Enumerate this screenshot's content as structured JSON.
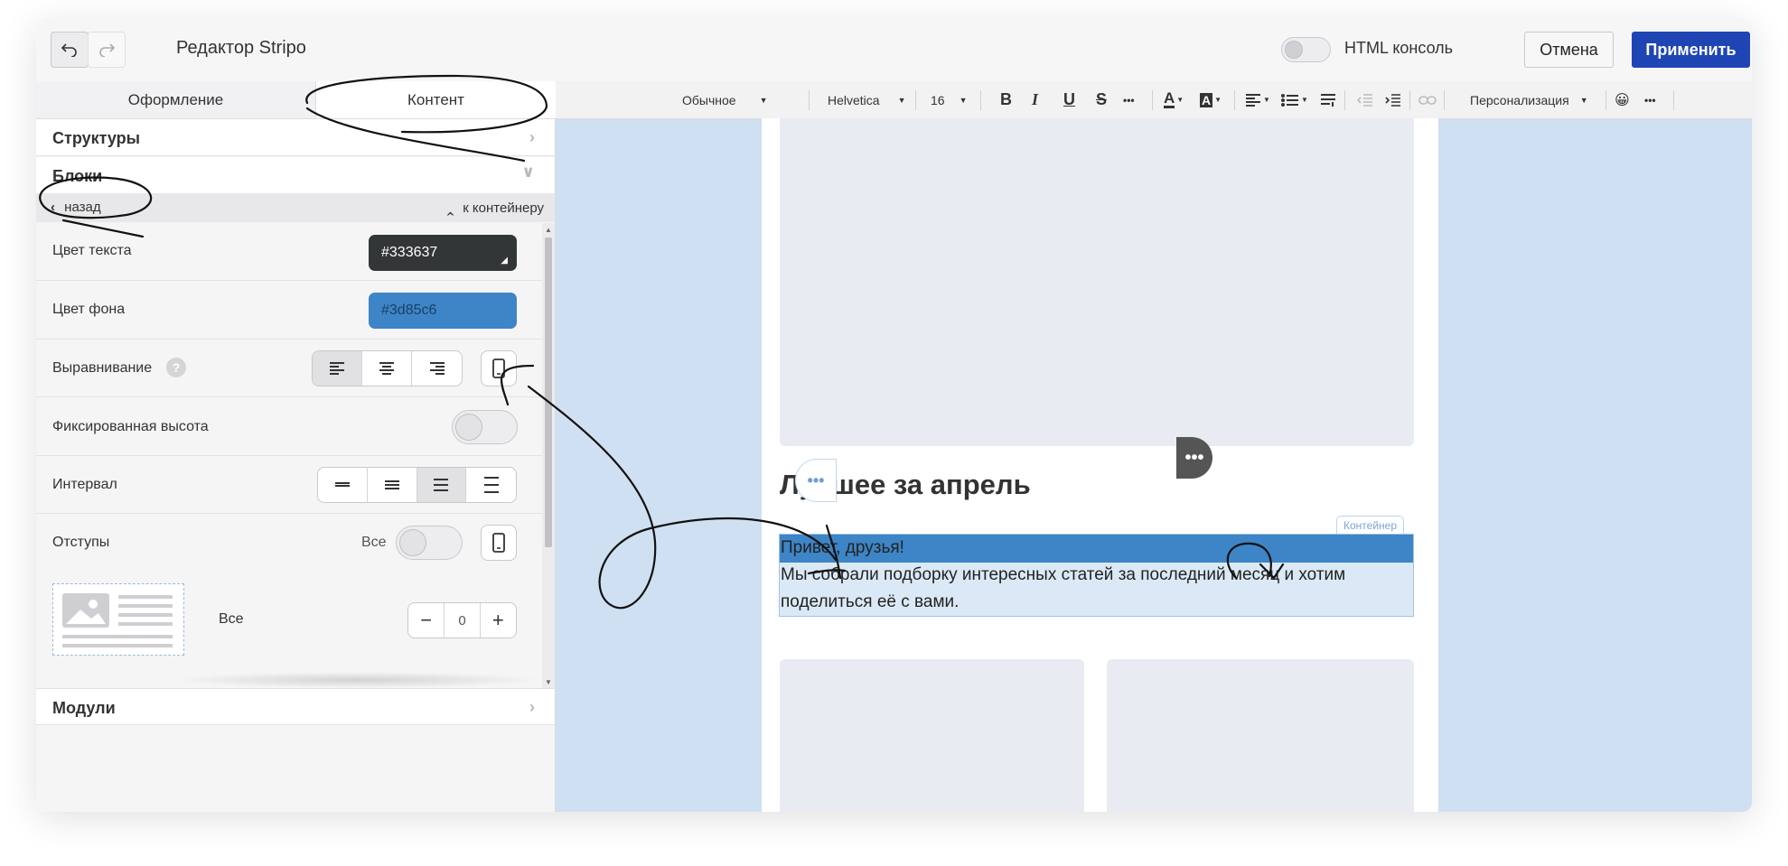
{
  "header": {
    "title": "Редактор Stripo",
    "html_console_label": "HTML консоль",
    "cancel_label": "Отмена",
    "apply_label": "Применить"
  },
  "left_panel": {
    "tabs": [
      {
        "label": "Оформление",
        "active": false
      },
      {
        "label": "Контент",
        "active": true
      }
    ],
    "sections": {
      "structures": "Структуры",
      "blocks": "Блоки",
      "modules": "Модули"
    },
    "subnav": {
      "back_label": "назад",
      "to_container_label": "к контейнеру"
    },
    "props": {
      "text_color_label": "Цвет текста",
      "text_color_value": "#333637",
      "bg_color_label": "Цвет фона",
      "bg_color_value": "#3d85c6",
      "align_label": "Выравнивание",
      "help_glyph": "?",
      "fixed_height_label": "Фиксированная высота",
      "interval_label": "Интервал",
      "padding_label": "Отступы",
      "padding_all_label": "Все",
      "padding_all_label2": "Все",
      "padding_value": "0",
      "minus_glyph": "−",
      "plus_glyph": "+"
    }
  },
  "toolbar": {
    "format": "Обычное",
    "font": "Helvetica",
    "size": "16",
    "bold": "B",
    "italic": "I",
    "underline": "U",
    "strike": "S",
    "more1": "•••",
    "text_color": "A",
    "bg_color": "A",
    "personalization": "Персонализация",
    "emoji": "😀",
    "more2": "•••"
  },
  "email": {
    "heading": "Лучшее за апрель",
    "line1": "Привет, друзья!",
    "line2": "Мы собрали подборку интересных статей за последний месяц и хотим поделиться её с вами.",
    "container_badge": "Контейнер",
    "dots": "•••"
  },
  "colors": {
    "accent": "#3d85c6",
    "apply_button": "#1f45b5",
    "text_color_swatch": "#333637",
    "canvas_bg": "#cfe0f2"
  }
}
